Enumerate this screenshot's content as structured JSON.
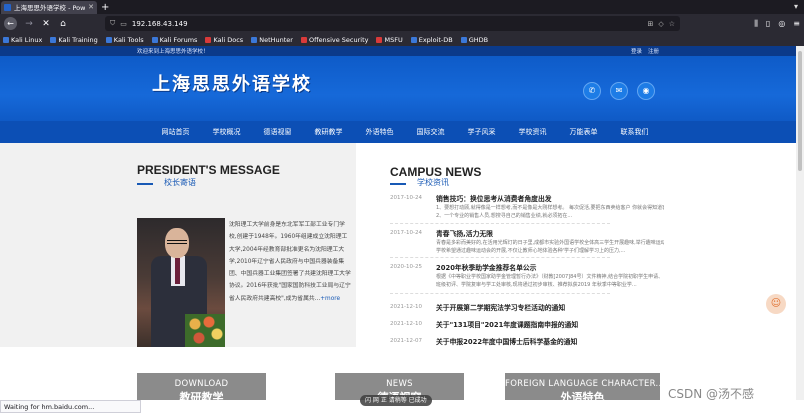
{
  "browser": {
    "tab_title": "上海思思外语学校 - Pow",
    "url": "192.168.43.149",
    "bookmarks": [
      "Kali Linux",
      "Kali Training",
      "Kali Tools",
      "Kali Forums",
      "Kali Docs",
      "NetHunter",
      "Offensive Security",
      "MSFU",
      "Exploit-DB",
      "GHDB"
    ],
    "status": "Waiting for hm.baidu.com..."
  },
  "site": {
    "welcome": "欢迎来到上海思思外语学校！",
    "login": "登录",
    "register": "注册",
    "logo": "上海思思外语学校",
    "nav": [
      "网站首页",
      "学校概况",
      "德语视窗",
      "教研教学",
      "外语特色",
      "国际交流",
      "学子风采",
      "学校资讯",
      "万能表单",
      "联系我们"
    ]
  },
  "president": {
    "title": "PRESIDENT'S MESSAGE",
    "subtitle": "校长寄语",
    "intro": "沈阳理工大学前身是东北军军工部工业专门学校,创建于1948年。1960年组建成立沈阳理工大学,2004年经教育部批准更名为沈阳理工大学,2010年辽宁省人民政府与中国兵器装备集团、中国兵器工业集团签署了共建沈阳理工大学协议。2016年获批\"国家国防科技工业局与辽宁省人民政府共建高校\",成为省属共...",
    "more": "+more"
  },
  "news": {
    "title": "CAMPUS NEWS",
    "subtitle": "学校资讯",
    "items": [
      {
        "date": "2017-10-24",
        "headline": "销售技巧：换位思考从消费者角度出发",
        "desc": [
          "1、要想打动顾,就得像是一样想考,而不是像是大刚样想考。 每次促活,要把东西卖给客户 你就会得知道客户在想什么,需要什么。",
          "2、一个专业的销售人员,想搜寻自己的销售业绩,就必须拓在..."
        ]
      },
      {
        "date": "2017-10-24",
        "headline": "青春飞扬,活力无限",
        "desc": [
          "青春是多彩而美好的,在活用光辉灯的日子里,成都市实验外国语学校全体高三学生开展趣味,举行趣味运动会。",
          "学校希望通过趣味运动会的开展,不仅让教师心地体验各种'学子们理解学习上的压力,..."
        ]
      },
      {
        "date": "2020-10-25",
        "headline": "2020年秋季助学金推荐名单公示",
        "desc": [
          "根据《中等职业学校国家助学金管理暂行办法》（财教[2007]84号）文件精神,结合学院初职学生申请、班级初评、学院复审与学工处审核,现将通过初步审核、推荐拟获2019 年秋季中等职业学...",
          ""
        ]
      },
      {
        "date": "2021-12-10",
        "headline": "关于开展第二学期宪法学习专栏活动的通知",
        "desc": [
          "",
          ""
        ]
      },
      {
        "date": "2021-12-10",
        "headline": "关于\"131项目\"2021年度课题指南申报的通知",
        "desc": [
          "",
          ""
        ]
      },
      {
        "date": "2021-12-07",
        "headline": "关于申报2022年度中国博士后科学基金的通知",
        "desc": [
          "",
          ""
        ]
      }
    ]
  },
  "cards": [
    {
      "en": "DOWNLOAD",
      "zh": "教研教学"
    },
    {
      "en": "NEWS",
      "zh": "德语视窗"
    },
    {
      "en": "FOREIGN LANGUAGE CHARACTER...",
      "zh": "外语特色"
    }
  ],
  "overlay": {
    "pill": "闪 网 正 请稍等 已成功",
    "watermark": "CSDN @汤不感"
  }
}
